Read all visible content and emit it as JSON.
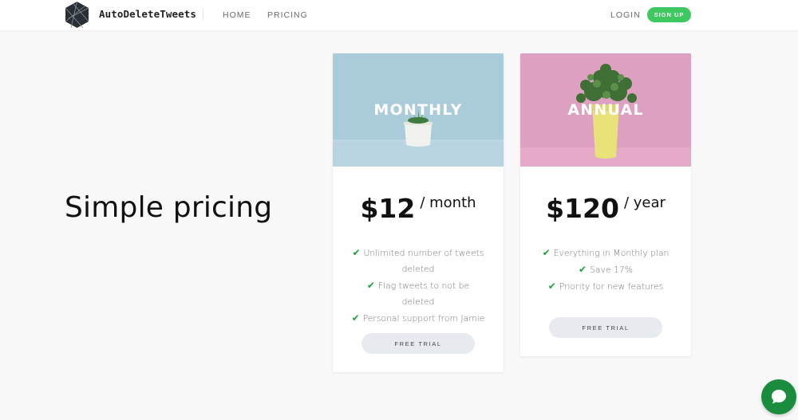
{
  "header": {
    "brand": "AutoDeleteTweets",
    "nav": {
      "home": "HOME",
      "pricing": "PRICING"
    },
    "login": "LOGIN",
    "signup": "SIGN UP",
    "icons": {
      "logo": "hexagon-logo-icon"
    }
  },
  "hero": {
    "headline": "Simple pricing"
  },
  "plans": {
    "monthly": {
      "title": "MONTHLY",
      "price": "$12",
      "unit": "/ month",
      "features": [
        "Unlimited number of tweets deleted",
        "Flag tweets to not be deleted",
        "Personal support from Jamie"
      ],
      "cta": "FREE TRIAL"
    },
    "annual": {
      "title": "ANNUAL",
      "price": "$120",
      "unit": "/ year",
      "features": [
        "Everything in Monthly plan",
        "Save 17%",
        "Priority for new features"
      ],
      "cta": "FREE TRIAL"
    }
  },
  "colors": {
    "accent_green": "#3ec85f",
    "check_green": "#1aa33a",
    "chat_green": "#1a8c3d",
    "monthly_bg": "#a9cbd9",
    "annual_bg": "#dea0c1"
  },
  "chat": {
    "icon": "chat-bubble-icon"
  }
}
